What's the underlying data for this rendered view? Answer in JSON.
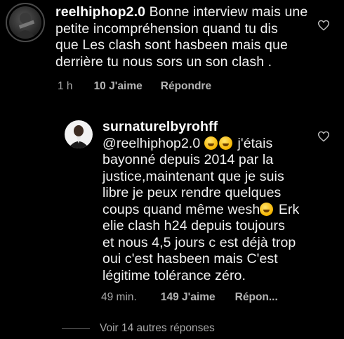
{
  "comment1": {
    "username": "reelhiphop2.0",
    "lines": [
      " Bonne interview mais une",
      "petite incompréhension quand tu dis",
      "que Les clash sont hasbeen mais que",
      "derrière tu nous sors un son clash ."
    ],
    "time": "1 h",
    "likes": "10 J'aime",
    "reply": "Répondre"
  },
  "reply1": {
    "username": "surnaturelbyrohff",
    "line1_text": "@reelhiphop2.0",
    "line1_after": " j'étais",
    "lines": [
      "bayonné depuis 2014 par la",
      "justice,maintenant que je suis",
      "libre je peux rendre quelques"
    ],
    "line5_before": "coups quand même wesh",
    "line5_after": " Erk",
    "lines_end": [
      "elie clash h24 depuis toujours",
      "et nous 4,5 jours c est déjà trop",
      "oui c'est hasbeen mais C'est",
      "légitime tolérance zéro."
    ],
    "time": "49 min.",
    "likes": "149 J'aime",
    "reply": "Répon..."
  },
  "more_replies": "Voir 14 autres réponses",
  "icons": {
    "heart": "heart-icon",
    "emoji_rofl": "rofl-emoji-icon",
    "emoji_laugh": "laughing-emoji-icon"
  },
  "colors": {
    "background": "#000000",
    "text": "#f2f2f2",
    "meta": "#a8a8a8"
  }
}
